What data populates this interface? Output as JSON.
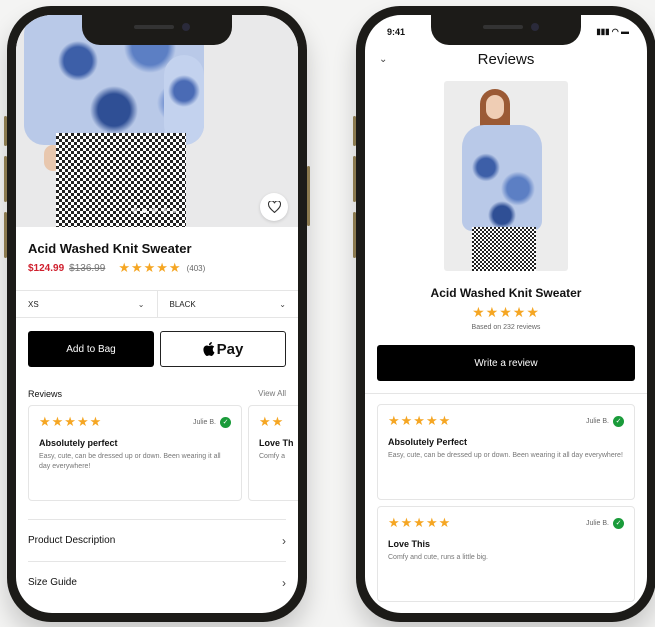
{
  "left": {
    "product_title": "Acid Washed Knit Sweater",
    "sale_price": "$124.99",
    "original_price": "$136.99",
    "rating_stars": "★★★★★",
    "review_count": "(403)",
    "size_value": "XS",
    "color_value": "BLACK",
    "add_to_bag": "Add to Bag",
    "pay_label": "Pay",
    "reviews_heading": "Reviews",
    "view_all": "View All",
    "reviews": [
      {
        "stars": "★★★★★",
        "author": "Julie B.",
        "title": "Absolutely perfect",
        "body": "Easy, cute, can be dressed up or down. Been wearing it all day everywhere!"
      },
      {
        "stars": "★★",
        "author": "",
        "title": "Love Th",
        "body": "Comfy a"
      }
    ],
    "menu": [
      {
        "label": "Product Description"
      },
      {
        "label": "Size Guide"
      }
    ]
  },
  "right": {
    "time": "9:41",
    "status_icons": "▮▮▮ ◠ ▬",
    "page_title": "Reviews",
    "product_title": "Acid Washed Knit Sweater",
    "rating_stars": "★★★★★",
    "based_on": "Based on 232 reviews",
    "write_review": "Write a review",
    "reviews": [
      {
        "stars": "★★★★★",
        "author": "Julie B.",
        "title": "Absolutely Perfect",
        "body": "Easy, cute, can be dressed up or down. Been wearing it all day everywhere!"
      },
      {
        "stars": "★★★★★",
        "author": "Julie B.",
        "title": "Love This",
        "body": "Comfy and cute, runs a little big."
      }
    ]
  },
  "colors": {
    "accent_sale": "#d0202e",
    "star": "#f5a623",
    "verified": "#1a9b3a"
  }
}
